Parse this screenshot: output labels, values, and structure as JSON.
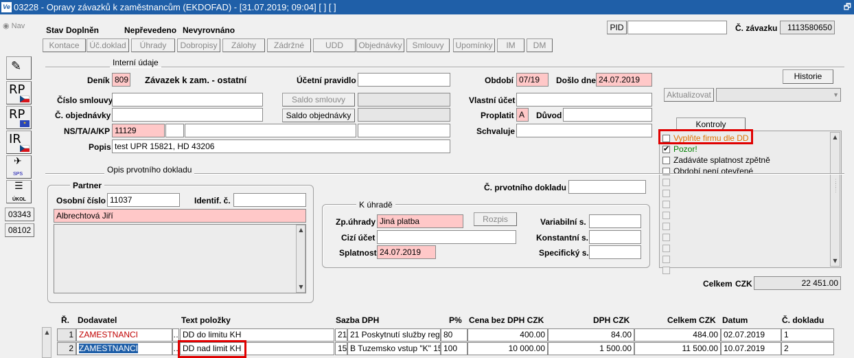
{
  "window": {
    "title": "03228 - Opravy závazků k zaměstnancům (EKDOFAD) - [31.07.2019; 09:04]  [ ]  [ ]",
    "app_icon": "Ve",
    "restore_glyph": "🗗"
  },
  "nav": {
    "label": "Nav"
  },
  "status": {
    "stav_label": "Stav",
    "stav_value": "Doplněn",
    "neprevedeno": "Nepřevedeno",
    "nevyrovnano": "Nevyrovnáno"
  },
  "pid": {
    "label": "PID",
    "value": ""
  },
  "zavazek": {
    "label": "Č. závazku",
    "value": "1113580650"
  },
  "toolbar": [
    "Kontace",
    "Úč.doklad",
    "Úhrady",
    "Dobropisy",
    "Zálohy",
    "Zádržné",
    "UDD",
    "Objednávky",
    "Smlouvy",
    "Upomínky",
    "IM",
    "DM"
  ],
  "side": {
    "rp1": "RP",
    "rp2": "RP",
    "ir": "IR",
    "sps": "SPS",
    "ukol": "ÚKOL",
    "num1": "03343",
    "num2": "08102"
  },
  "interni": {
    "section": "Interní údaje",
    "denik_label": "Deník",
    "denik_code": "809",
    "denik_name": "Závazek k zam. - ostatní",
    "ucetni_label": "Účetní pravidlo",
    "ucetni_value": "",
    "obdobi_label": "Období",
    "obdobi_value": "07/19",
    "doslo_label": "Došlo dne",
    "doslo_value": "24.07.2019",
    "historie": "Historie",
    "smlouvy_label": "Číslo smlouvy",
    "smlouvy_value": "",
    "saldo_smlouvy": "Saldo smlouvy",
    "vlastni_label": "Vlastní účet",
    "vlastni_value": "",
    "aktualizovat": "Aktualizovat",
    "objednavky_label": "Č. objednávky",
    "objednavky_value": "",
    "saldo_objednavky": "Saldo objednávky",
    "proplatit_label": "Proplatit",
    "proplatit_value": "A",
    "duvod_label": "Důvod",
    "duvod_value": "",
    "ns_label": "NS/TA/A/KP",
    "ns_value": "11129",
    "schvaluje_label": "Schvaluje",
    "schvaluje_value": "",
    "popis_label": "Popis",
    "popis_value": "test UPR 15821, HD 43206"
  },
  "kontroly": {
    "button": "Kontroly",
    "items": [
      {
        "text": "Vyplňte firmu dle DD",
        "checked": false,
        "color": "#e07000"
      },
      {
        "text": "Pozor!",
        "checked": true,
        "color": "#008000"
      },
      {
        "text": "Zadáváte splatnost zpětně",
        "checked": false,
        "color": "#000000"
      },
      {
        "text": "Období není otevřené",
        "checked": false,
        "color": "#000000"
      }
    ],
    "highlight_color": "#e00000"
  },
  "opis": {
    "section": "Opis prvotního dokladu",
    "partner_title": "Partner",
    "osobni_label": "Osobní číslo",
    "osobni_value": "11037",
    "identif_label": "Identif. č.",
    "identif_value": "",
    "partner_name": "Albrechtová Jiří",
    "prvotni_label": "Č. prvotního dokladu",
    "prvotni_value": ""
  },
  "uhrada": {
    "title": "K úhradě",
    "zp_label": "Zp.úhrady",
    "zp_value": "Jiná platba",
    "rozpis": "Rozpis",
    "variabilni_label": "Variabilní s.",
    "variabilni_value": "",
    "cizi_label": "Cizí účet",
    "cizi_value": "",
    "konstantni_label": "Konstantní s.",
    "konstantni_value": "",
    "splatnost_label": "Splatnost",
    "splatnost_value": "24.07.2019",
    "specificky_label": "Specifický s.",
    "specificky_value": ""
  },
  "celkem": {
    "label": "Celkem",
    "currency": "CZK",
    "value": "22 451.00"
  },
  "table": {
    "headers": {
      "r": "Ř.",
      "dodavatel": "Dodavatel",
      "text": "Text položky",
      "sazba": "Sazba DPH",
      "p": "P%",
      "cena": "Cena bez DPH  CZK",
      "dph": "DPH  CZK",
      "celkem": "Celkem  CZK",
      "datum": "Datum",
      "doklad": "Č. dokladu"
    },
    "rows": [
      {
        "r": "1",
        "dodavatel": "ZAMESTNANCI",
        "text": "DD do limitu KH",
        "sazba_code": "21",
        "sazba_text": "21  Poskytnutí služby reg",
        "p": "80",
        "cena": "400.00",
        "dph": "84.00",
        "celkem": "484.00",
        "datum": "02.07.2019",
        "doklad": "1"
      },
      {
        "r": "2",
        "dodavatel": "ZAMESTNANCI",
        "text": "DD nad limit KH",
        "sazba_code": "15",
        "sazba_text": "B  Tuzemsko vstup \"K\" 15",
        "p": "100",
        "cena": "10 000.00",
        "dph": "1 500.00",
        "celkem": "11 500.00",
        "datum": "10.07.2019",
        "doklad": "2"
      }
    ]
  }
}
